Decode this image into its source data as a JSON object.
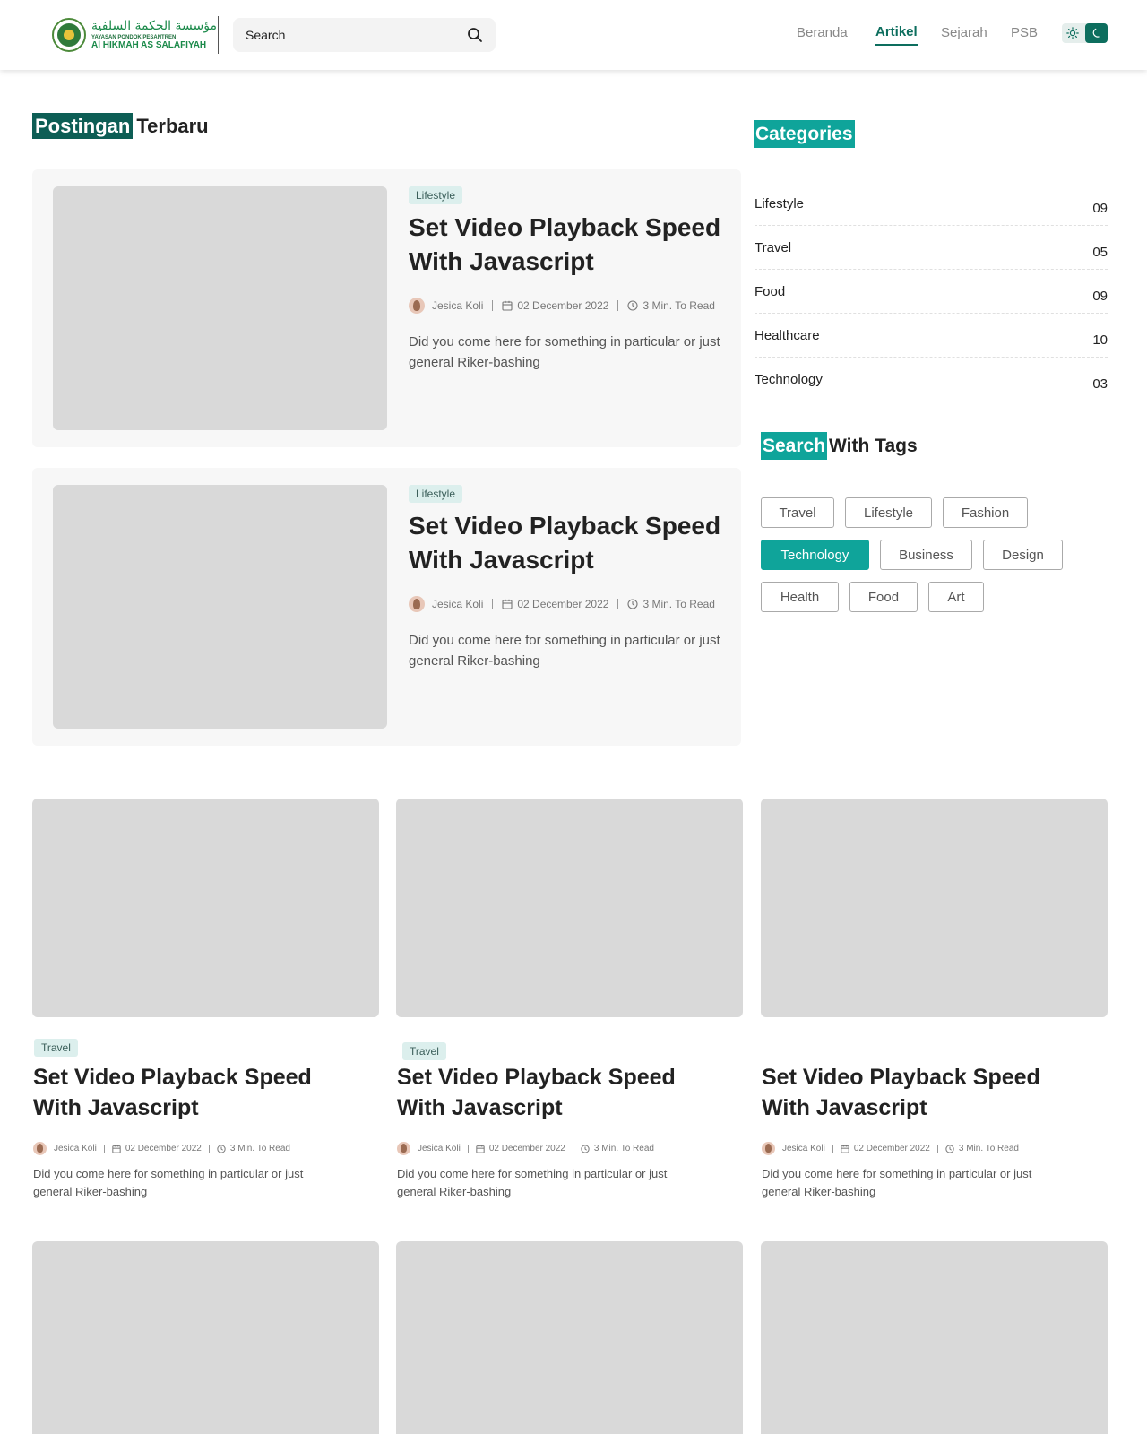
{
  "header": {
    "logo": {
      "arabic": "مؤسسة الحكمة السلفية",
      "subtitle": "YAYASAN PONDOK PESANTREN",
      "name": "Al HIKMAH AS SALAFIYAH"
    },
    "search": {
      "placeholder": "Search",
      "icon": "search-icon"
    },
    "nav": [
      {
        "label": "Beranda",
        "active": false
      },
      {
        "label": "Artikel",
        "active": true
      },
      {
        "label": "Sejarah",
        "active": false
      },
      {
        "label": "PSB",
        "active": false
      }
    ],
    "theme_toggle": {
      "light_icon": "sun-icon",
      "dark_icon": "moon-icon",
      "active": "dark"
    }
  },
  "latest": {
    "heading_highlight": "Postingan",
    "heading_rest": "Terbaru",
    "posts": [
      {
        "category": "Lifestyle",
        "title": "Set Video Playback Speed With Javascript",
        "author": "Jesica Koli",
        "date": "02 December 2022",
        "read_time": "3 Min. To Read",
        "excerpt": "Did you come here for something in particular or just general Riker-bashing"
      },
      {
        "category": "Lifestyle",
        "title": "Set Video Playback Speed With Javascript",
        "author": "Jesica Koli",
        "date": "02 December 2022",
        "read_time": "3 Min. To Read",
        "excerpt": "Did you come here for something in particular or just general Riker-bashing"
      }
    ]
  },
  "categories": {
    "heading": "Categories",
    "items": [
      {
        "name": "Lifestyle",
        "count": "09"
      },
      {
        "name": "Travel",
        "count": "05"
      },
      {
        "name": "Food",
        "count": "09"
      },
      {
        "name": "Healthcare",
        "count": "10"
      },
      {
        "name": "Technology",
        "count": "03"
      }
    ]
  },
  "tags": {
    "heading_highlight": "Search",
    "heading_rest": "With Tags",
    "items": [
      {
        "label": "Travel",
        "active": false
      },
      {
        "label": "Lifestyle",
        "active": false
      },
      {
        "label": "Fashion",
        "active": false
      },
      {
        "label": "Technology",
        "active": true
      },
      {
        "label": "Business",
        "active": false
      },
      {
        "label": "Design",
        "active": false
      },
      {
        "label": "Health",
        "active": false
      },
      {
        "label": "Food",
        "active": false
      },
      {
        "label": "Art",
        "active": false
      }
    ]
  },
  "grid": {
    "posts": [
      {
        "category": "Travel",
        "title": "Set Video Playback Speed With Javascript",
        "author": "Jesica Koli",
        "date": "02 December 2022",
        "read_time": "3 Min. To Read",
        "excerpt": "Did you come here for something in particular or just general Riker-bashing"
      },
      {
        "category": "Travel",
        "title": "Set Video Playback Speed With Javascript",
        "author": "Jesica Koli",
        "date": "02 December 2022",
        "read_time": "3 Min. To Read",
        "excerpt": "Did you come here for something in particular or just general Riker-bashing"
      },
      {
        "category": "",
        "title": "Set Video Playback Speed With Javascript",
        "author": "Jesica Koli",
        "date": "02 December 2022",
        "read_time": "3 Min. To Read",
        "excerpt": "Did you come here for something in particular or just general Riker-bashing"
      }
    ]
  },
  "colors": {
    "brand_dark": "#0d5e55",
    "brand_teal": "#0fa49a",
    "nav_active": "#0d6e5e"
  }
}
